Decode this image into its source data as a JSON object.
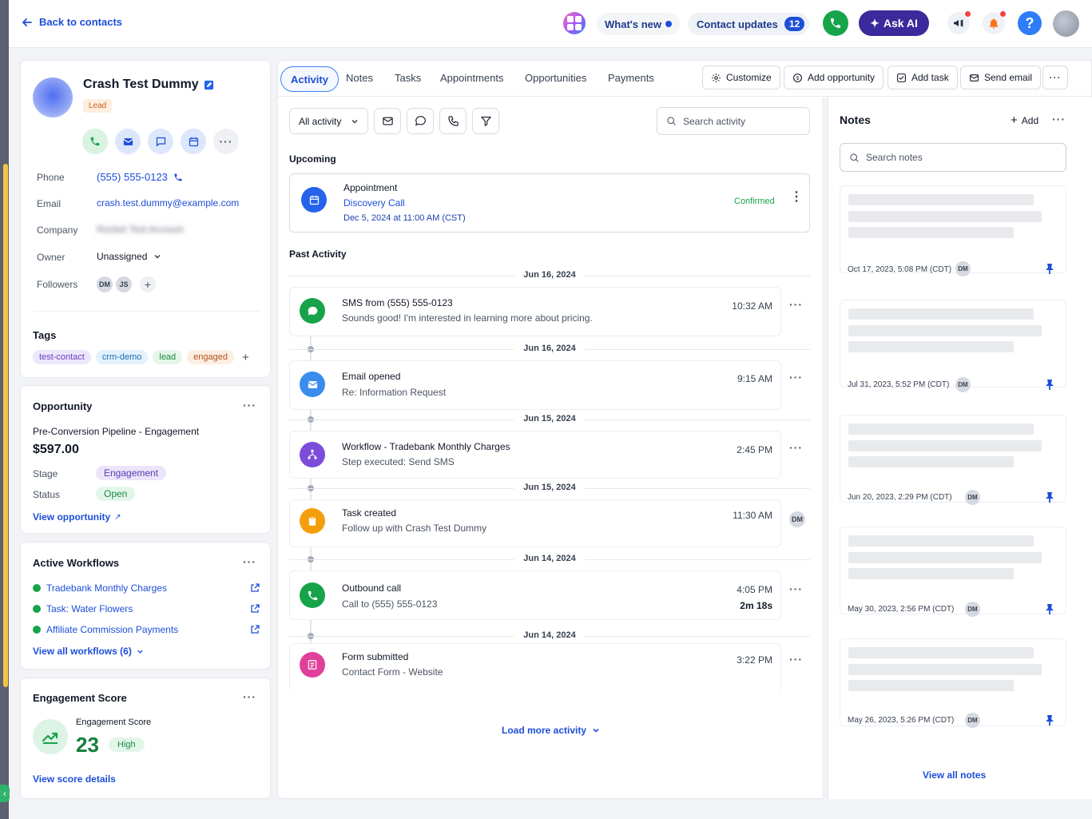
{
  "header": {
    "back_label": "Back to contacts",
    "whats_new": "What's new",
    "contact_updates": "Contact updates",
    "contact_updates_count": "12",
    "ask_ai": "Ask AI",
    "help": "?"
  },
  "contact": {
    "name": "Crash Test Dummy",
    "badge": "Lead",
    "fields": {
      "phone_label": "Phone",
      "phone": "(555) 555-0123",
      "email_label": "Email",
      "email": "crash.test.dummy@example.com",
      "company_label": "Company",
      "company": "Rocket Test Account",
      "owner_label": "Owner",
      "owner": "Unassigned",
      "followers_label": "Followers",
      "followers": [
        "DM",
        "JS"
      ]
    },
    "tags_title": "Tags",
    "tags": [
      {
        "label": "test-contact",
        "bg": "#ede7fb",
        "fg": "#6d3fc0"
      },
      {
        "label": "crm-demo",
        "bg": "#e3f2fc",
        "fg": "#1e6fae"
      },
      {
        "label": "lead",
        "bg": "#e5f6ea",
        "fg": "#1e8a45"
      },
      {
        "label": "engaged",
        "bg": "#fdeee2",
        "fg": "#b4541b"
      }
    ]
  },
  "opportunity": {
    "title": "Opportunity",
    "pipeline": "Pre-Conversion Pipeline - Engagement",
    "amount": "$597.00",
    "stage_label": "Stage",
    "stage": "Engagement",
    "status_label": "Status",
    "status": "Open",
    "view_link": "View opportunity"
  },
  "workflows": {
    "title": "Active Workflows",
    "items": [
      "Tradebank Monthly Charges",
      "Task: Water Flowers",
      "Affiliate Commission Payments"
    ],
    "view_all": "View all workflows (6)"
  },
  "engagement": {
    "title": "Engagement Score",
    "label": "Engagement Score",
    "score": "23",
    "level": "High",
    "link": "View score details"
  },
  "tabs": [
    "Activity",
    "Notes",
    "Tasks",
    "Appointments",
    "Opportunities",
    "Payments"
  ],
  "toolbar": {
    "customize": "Customize",
    "add_opportunity": "Add opportunity",
    "add_task": "Add task",
    "send_email": "Send email"
  },
  "activity": {
    "filter": "All activity",
    "search_placeholder": "Search activity",
    "upcoming_title": "Upcoming",
    "upcoming": {
      "type": "Appointment",
      "title": "Discovery Call",
      "when": "Dec 5, 2024 at 11:00 AM (CST)",
      "status": "Confirmed"
    },
    "past_title": "Past Activity",
    "items": [
      {
        "date": "Jun 16, 2024",
        "title": "SMS from (555) 555-0123",
        "sub": "Sounds good! I'm interested in learning more about pricing.",
        "time": "10:32 AM",
        "icon": "chat-icon",
        "color": "#16a34a"
      },
      {
        "date": "Jun 16, 2024",
        "title": "Email opened",
        "sub": "Re: Information Request",
        "time": "9:15 AM",
        "icon": "mail-icon",
        "color": "#3b8ded"
      },
      {
        "date": "Jun 15, 2024",
        "title": "Workflow - Tradebank Monthly Charges",
        "sub": "Step executed: Send SMS",
        "time": "2:45 PM",
        "icon": "workflow-icon",
        "color": "#7c4ddb"
      },
      {
        "date": "Jun 15, 2024",
        "title": "Task created",
        "sub": "Follow up with Crash Test Dummy",
        "time": "11:30 AM",
        "icon": "clipboard-icon",
        "color": "#f59e0b",
        "avatar": "DM"
      },
      {
        "date": "Jun 14, 2024",
        "title": "Outbound call",
        "sub": "Call to (555) 555-0123",
        "time": "4:05 PM",
        "duration": "2m 18s",
        "icon": "phone-icon",
        "color": "#16a34a"
      },
      {
        "date": "Jun 14, 2024",
        "title": "Form submitted",
        "sub": "Contact Form - Website",
        "time": "3:22 PM",
        "icon": "form-icon",
        "color": "#e0409a"
      }
    ],
    "load_more": "Load more activity"
  },
  "notes": {
    "title": "Notes",
    "add": "Add",
    "search_placeholder": "Search notes",
    "items": [
      {
        "date": "Oct 17, 2023, 5:08 PM (CDT)",
        "author": "DM"
      },
      {
        "date": "Jul 31, 2023, 5:52 PM (CDT)",
        "author": "DM"
      },
      {
        "date": "Jun 20, 2023, 2:29 PM (CDT)",
        "author": "DM"
      },
      {
        "date": "May 30, 2023, 2:56 PM (CDT)",
        "author": "DM"
      },
      {
        "date": "May 26, 2023, 5:26 PM (CDT)",
        "author": "DM"
      }
    ],
    "view_all": "View all notes"
  }
}
